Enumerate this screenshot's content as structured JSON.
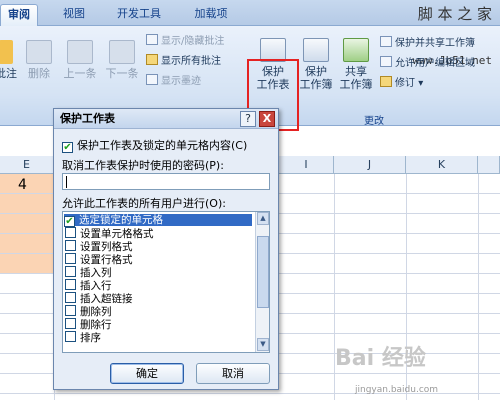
{
  "ribbon_tabs": [
    "审阅",
    "视图",
    "开发工具",
    "加载项"
  ],
  "watermark_top": "脚 本 之 家",
  "watermark_url": "www.Jb51.net",
  "comments": {
    "left_partial": "批注",
    "delete": "删除",
    "prev": "上一条",
    "next": "下一条",
    "toggle": "显示/隐藏批注",
    "show_all": "显示所有批注",
    "show_ink": "显示墨迹"
  },
  "changes": {
    "protect_sheet": [
      "保护",
      "工作表"
    ],
    "protect_book": [
      "保护",
      "工作簿"
    ],
    "share_book": [
      "共享",
      "工作簿"
    ],
    "protect_share": "保护并共享工作簿",
    "allow_edit": "允许用户编辑区域",
    "track": "修订",
    "group_label": "更改"
  },
  "columns": [
    "E",
    "F",
    "G",
    "H",
    "I",
    "J",
    "K"
  ],
  "cell_value": "4",
  "dialog": {
    "title": "保护工作表",
    "help_btn": "?",
    "close_btn": "X",
    "protect_check": "保护工作表及锁定的单元格内容(C)",
    "password_label": "取消工作表保护时使用的密码(P):",
    "password_value": "",
    "allow_label": "允许此工作表的所有用户进行(O):",
    "options": [
      {
        "label": "选定锁定的单元格",
        "checked": true
      },
      {
        "label": "设置单元格格式",
        "checked": false
      },
      {
        "label": "设置列格式",
        "checked": false
      },
      {
        "label": "设置行格式",
        "checked": false
      },
      {
        "label": "插入列",
        "checked": false
      },
      {
        "label": "插入行",
        "checked": false
      },
      {
        "label": "插入超链接",
        "checked": false
      },
      {
        "label": "删除列",
        "checked": false
      },
      {
        "label": "删除行",
        "checked": false
      },
      {
        "label": "排序",
        "checked": false
      }
    ],
    "ok": "确定",
    "cancel": "取消"
  },
  "watermark_baidu": "Bai 经验",
  "watermark_baidu_url": "jingyan.baidu.com",
  "colors": {
    "accent": "#316ac5",
    "highlight": "#e52222",
    "cell_fill": "#fbd4b4"
  }
}
